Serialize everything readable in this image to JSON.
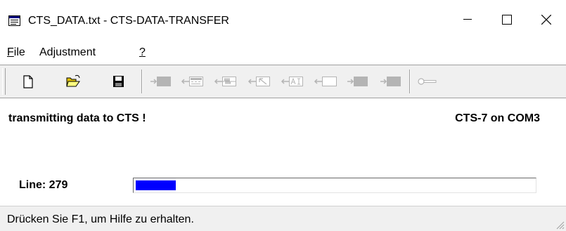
{
  "window": {
    "title": "CTS_DATA.txt - CTS-DATA-TRANSFER"
  },
  "menu": {
    "file": {
      "prefix": "F",
      "rest": "ile"
    },
    "adjustment": "Adjustment",
    "help": "?"
  },
  "toolbar": {
    "buttons": [
      {
        "icon": "new-document-icon"
      },
      {
        "icon": "open-folder-icon"
      },
      {
        "icon": "save-icon"
      },
      {
        "icon": "send-block-icon"
      },
      {
        "icon": "send-form-icon"
      },
      {
        "icon": "send-waveform-icon"
      },
      {
        "icon": "send-cursor-icon"
      },
      {
        "icon": "send-ai-icon"
      },
      {
        "icon": "send-empty-icon"
      },
      {
        "icon": "receive-block-icon"
      },
      {
        "icon": "transfer-block-icon"
      },
      {
        "icon": "key-icon"
      }
    ]
  },
  "main": {
    "status": "transmitting data to CTS !",
    "device": "CTS-7 on COM3",
    "line_label": "Line: 279",
    "progress_fraction": 0.1
  },
  "statusbar": {
    "hint": "Drücken Sie F1, um Hilfe zu erhalten."
  },
  "colors": {
    "progress": "#0000ff",
    "toolbar_bg": "#f0f0f0",
    "disabled_icon": "#b4b4b4"
  }
}
